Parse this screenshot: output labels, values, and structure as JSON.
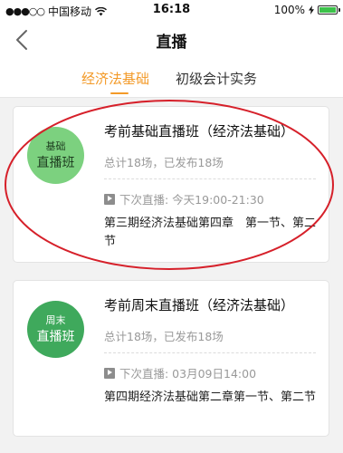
{
  "status": {
    "carrier": "中国移动",
    "time": "16:18",
    "battery": "100%"
  },
  "nav": {
    "title": "直播"
  },
  "tabs": [
    {
      "label": "经济法基础",
      "active": true
    },
    {
      "label": "初级会计实务",
      "active": false
    }
  ],
  "cards": [
    {
      "badge_top": "基础",
      "badge_bottom": "直播班",
      "title": "考前基础直播班（经济法基础）",
      "summary": "总计18场，已发布18场",
      "next_live": "下次直播: 今天19:00-21:30",
      "description": "第三期经济法基础第四章　第一节、第二节"
    },
    {
      "badge_top": "周末",
      "badge_bottom": "直播班",
      "title": "考前周末直播班（经济法基础）",
      "summary": "总计18场，已发布18场",
      "next_live": "下次直播: 03月09日14:00",
      "description": "第四期经济法基础第二章第一节、第二节"
    }
  ],
  "colors": {
    "accent": "#f39a28",
    "annotation": "#d6202a"
  }
}
